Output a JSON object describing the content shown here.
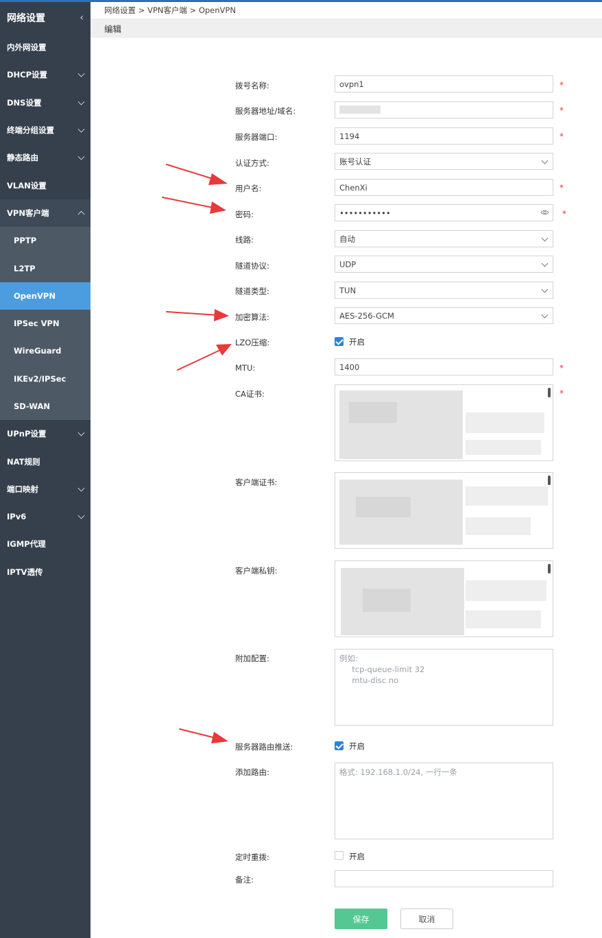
{
  "sidebar": {
    "title": "网络设置",
    "items": [
      {
        "label": "内外网设置"
      },
      {
        "label": "DHCP设置"
      },
      {
        "label": "DNS设置"
      },
      {
        "label": "终端分组设置"
      },
      {
        "label": "静态路由"
      },
      {
        "label": "VLAN设置"
      },
      {
        "label": "VPN客户端"
      },
      {
        "label": "UPnP设置"
      },
      {
        "label": "NAT规则"
      },
      {
        "label": "端口映射"
      },
      {
        "label": "IPv6"
      },
      {
        "label": "IGMP代理"
      },
      {
        "label": "IPTV透传"
      }
    ],
    "vpn_sub": [
      {
        "label": "PPTP"
      },
      {
        "label": "L2TP"
      },
      {
        "label": "OpenVPN"
      },
      {
        "label": "IPSec VPN"
      },
      {
        "label": "WireGuard"
      },
      {
        "label": "IKEv2/IPSec"
      },
      {
        "label": "SD-WAN"
      }
    ]
  },
  "breadcrumb": [
    "网络设置",
    "VPN客户端",
    "OpenVPN"
  ],
  "edit_title": "编辑",
  "form": {
    "dial_name": {
      "label": "拨号名称:",
      "value": "ovpn1"
    },
    "server_addr": {
      "label": "服务器地址/域名:"
    },
    "server_port": {
      "label": "服务器端口:",
      "value": "1194"
    },
    "auth_method": {
      "label": "认证方式:",
      "value": "账号认证"
    },
    "username": {
      "label": "用户名:",
      "value": "ChenXi"
    },
    "password": {
      "label": "密码:",
      "value": "•••••••••••"
    },
    "line": {
      "label": "线路:",
      "value": "自动"
    },
    "tunnel_protocol": {
      "label": "隧道协议:",
      "value": "UDP"
    },
    "tunnel_type": {
      "label": "隧道类型:",
      "value": "TUN"
    },
    "cipher": {
      "label": "加密算法:",
      "value": "AES-256-GCM"
    },
    "lzo": {
      "label": "LZO压缩:",
      "checked": true,
      "text": "开启"
    },
    "mtu": {
      "label": "MTU:",
      "value": "1400"
    },
    "ca_cert": {
      "label": "CA证书:"
    },
    "client_cert": {
      "label": "客户端证书:"
    },
    "client_key": {
      "label": "客户端私钥:"
    },
    "extra_config": {
      "label": "附加配置:",
      "placeholder": "例如:\n     tcp-queue-limit 32\n     mtu-disc no"
    },
    "route_push": {
      "label": "服务器路由推送:",
      "checked": true,
      "text": "开启"
    },
    "add_route": {
      "label": "添加路由:",
      "placeholder": "格式: 192.168.1.0/24, 一行一条"
    },
    "redial": {
      "label": "定时重拨:",
      "checked": false,
      "text": "开启"
    },
    "remark": {
      "label": "备注:",
      "value": ""
    },
    "required_mark": "*"
  },
  "buttons": {
    "save": "保存",
    "cancel": "取消"
  },
  "colors": {
    "sidebar_bg": "#36404d",
    "active_item": "#4b9ddf",
    "save_button": "#54c792",
    "checkbox": "#2a84d8",
    "arrow": "#e8393b"
  }
}
